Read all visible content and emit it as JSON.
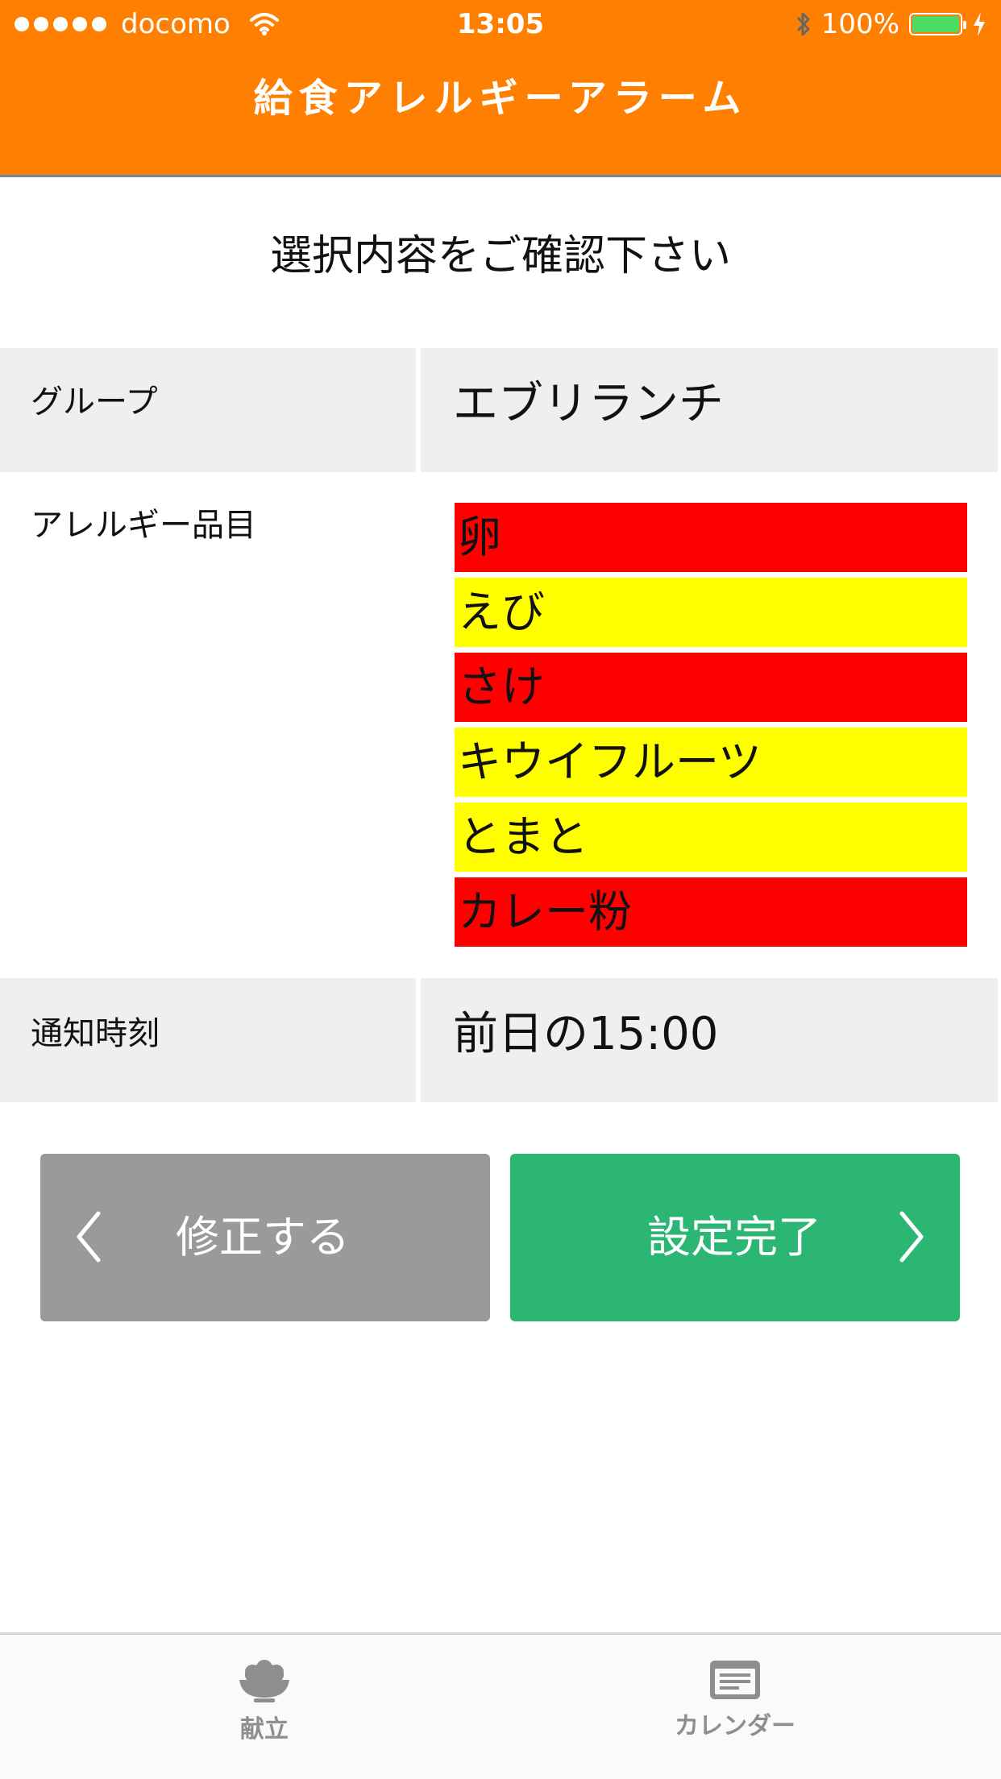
{
  "status_bar": {
    "carrier": "docomo",
    "time": "13:05",
    "battery": "100%",
    "battery_level": 1.0,
    "colors": {
      "battery_fill": "#4cd964"
    }
  },
  "header": {
    "title": "給食アレルギーアラーム",
    "color": "#ff8000"
  },
  "page": {
    "confirm_title": "選択内容をご確認下さい"
  },
  "table": {
    "group_label": "グループ",
    "group_value": "エブリランチ",
    "allergy_label": "アレルギー品目",
    "allergy_items": [
      {
        "name": "卵",
        "color": "#ff0000"
      },
      {
        "name": "えび",
        "color": "#ffff00"
      },
      {
        "name": "さけ",
        "color": "#ff0000"
      },
      {
        "name": "キウイフルーツ",
        "color": "#ffff00"
      },
      {
        "name": "とまと",
        "color": "#ffff00"
      },
      {
        "name": "カレー粉",
        "color": "#ff0000"
      }
    ],
    "notify_label": "通知時刻",
    "notify_value": "前日の15:00"
  },
  "buttons": {
    "edit_label": "修正する",
    "edit_icon": "chevron-left-icon",
    "done_label": "設定完了",
    "done_icon": "chevron-right-icon",
    "colors": {
      "edit": "#9a9a9a",
      "done": "#2bb673"
    }
  },
  "tabbar": {
    "items": [
      {
        "label": "献立",
        "icon": "rice-bowl-icon"
      },
      {
        "label": "カレンダー",
        "icon": "calendar-icon"
      }
    ]
  }
}
